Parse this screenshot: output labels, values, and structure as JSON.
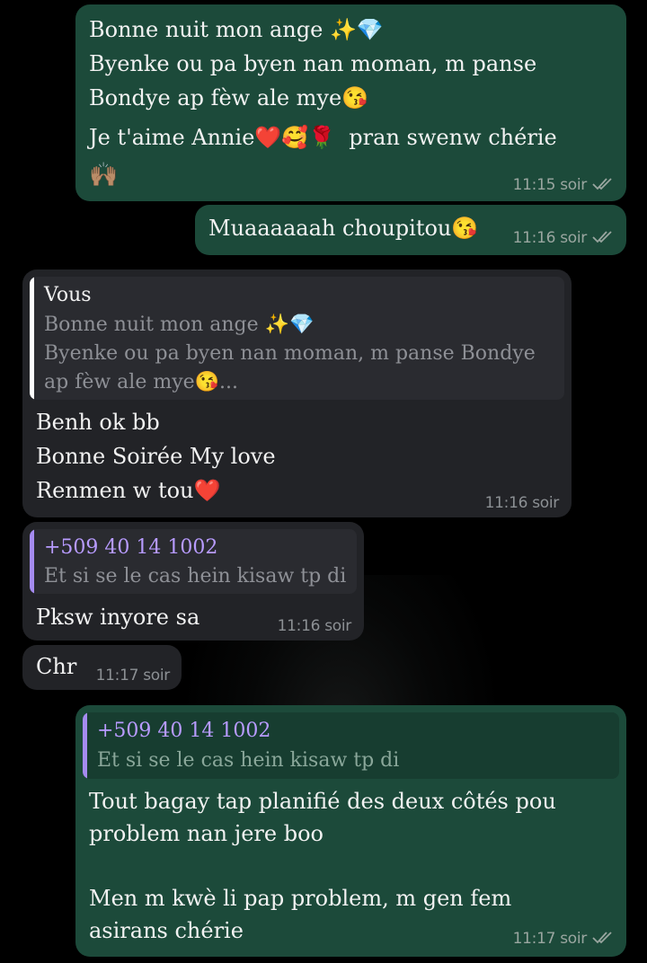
{
  "theme": {
    "outgoing_bg": "#1c4a3a",
    "incoming_bg": "#222327",
    "reply_bar_self": "#ffffff",
    "reply_bar_contact": "#a58bf0",
    "contact_name_color": "#b89bff"
  },
  "messages": [
    {
      "lines": [
        "Bonne nuit mon ange ✨💎",
        "Byenke ou pa byen nan moman, m panse",
        "Bondye ap fèw ale mye😘",
        "Je t'aime Annie❤️🥰🌹  pran swenw chérie",
        "🙌🏽"
      ],
      "time": "11:15 soir",
      "read": "read-check-icon"
    },
    {
      "lines": [
        "Muaaaaaah choupitou😘"
      ],
      "time": "11:16 soir",
      "read": "read-check-icon"
    },
    {
      "reply": {
        "name": "Vous",
        "lines": [
          "Bonne nuit mon ange ✨💎",
          "Byenke ou pa byen nan moman, m panse Bondye",
          "ap fèw ale mye😘..."
        ]
      },
      "lines": [
        "Benh ok bb",
        "Bonne Soirée My love",
        "Renmen w tou❤️"
      ],
      "time": "11:16 soir"
    },
    {
      "reply": {
        "name": "+509 40 14 1002",
        "lines": [
          "Et si se le cas hein kisaw tp di"
        ]
      },
      "lines": [
        "Pksw inyore sa"
      ],
      "time": "11:16 soir"
    },
    {
      "lines": [
        "Chr"
      ],
      "time": "11:17 soir"
    },
    {
      "reply": {
        "name": "+509 40 14 1002",
        "lines": [
          "Et si se le cas hein kisaw tp di"
        ]
      },
      "lines": [
        "Tout bagay tap planifié des deux côtés pou",
        "problem nan jere boo",
        "",
        "Men m kwè li pap problem, m gen fem",
        "asirans chérie"
      ],
      "time": "11:17 soir",
      "read": "read-check-icon"
    }
  ]
}
